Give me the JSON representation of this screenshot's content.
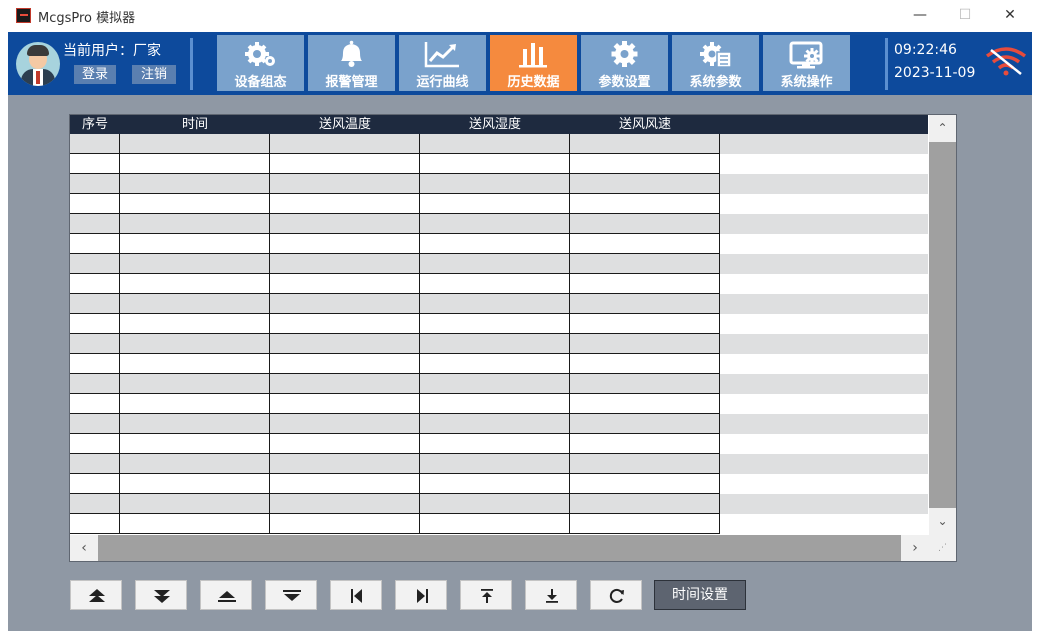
{
  "window": {
    "title": "McgsPro 模拟器",
    "minimize_glyph": "—",
    "maximize_glyph": "☐",
    "close_glyph": "✕"
  },
  "header": {
    "user_label": "当前用户：",
    "user_name": "厂家",
    "login_label": "登录",
    "logout_label": "注销",
    "time": "09:22:46",
    "date": "2023-11-09",
    "nav": [
      {
        "label": "设备组态",
        "icon": "gears-icon",
        "active": false
      },
      {
        "label": "报警管理",
        "icon": "bell-icon",
        "active": false
      },
      {
        "label": "运行曲线",
        "icon": "trend-chart-icon",
        "active": false
      },
      {
        "label": "历史数据",
        "icon": "bar-chart-icon",
        "active": true
      },
      {
        "label": "参数设置",
        "icon": "gear-icon",
        "active": false
      },
      {
        "label": "系统参数",
        "icon": "gear-document-icon",
        "active": false
      },
      {
        "label": "系统操作",
        "icon": "monitor-gear-icon",
        "active": false
      }
    ],
    "colors": {
      "header_bg": "#0d4a9c",
      "nav_bg": "#7aa2cc",
      "nav_active_bg": "#f58a3e"
    }
  },
  "table": {
    "columns": [
      "序号",
      "时间",
      "送风温度",
      "送风湿度",
      "送风风速"
    ],
    "row_count": 20,
    "rows": []
  },
  "toolbar": {
    "buttons": [
      {
        "name": "page-up-button",
        "icon": "double-up-arrow-icon"
      },
      {
        "name": "page-down-button",
        "icon": "double-down-arrow-icon"
      },
      {
        "name": "scroll-to-top-button",
        "icon": "up-arrow-bar-icon"
      },
      {
        "name": "scroll-to-bottom-button",
        "icon": "down-arrow-bar-icon"
      },
      {
        "name": "first-record-button",
        "icon": "skip-to-start-icon"
      },
      {
        "name": "last-record-button",
        "icon": "skip-to-end-icon"
      },
      {
        "name": "move-to-top-button",
        "icon": "arrow-up-to-line-icon"
      },
      {
        "name": "move-to-bottom-button",
        "icon": "arrow-down-to-line-icon"
      },
      {
        "name": "refresh-button",
        "icon": "refresh-icon"
      }
    ],
    "time_setting_label": "时间设置"
  },
  "scroll": {
    "up": "⌃",
    "down": "⌄",
    "left": "‹",
    "right": "›",
    "grip": "⋰"
  }
}
